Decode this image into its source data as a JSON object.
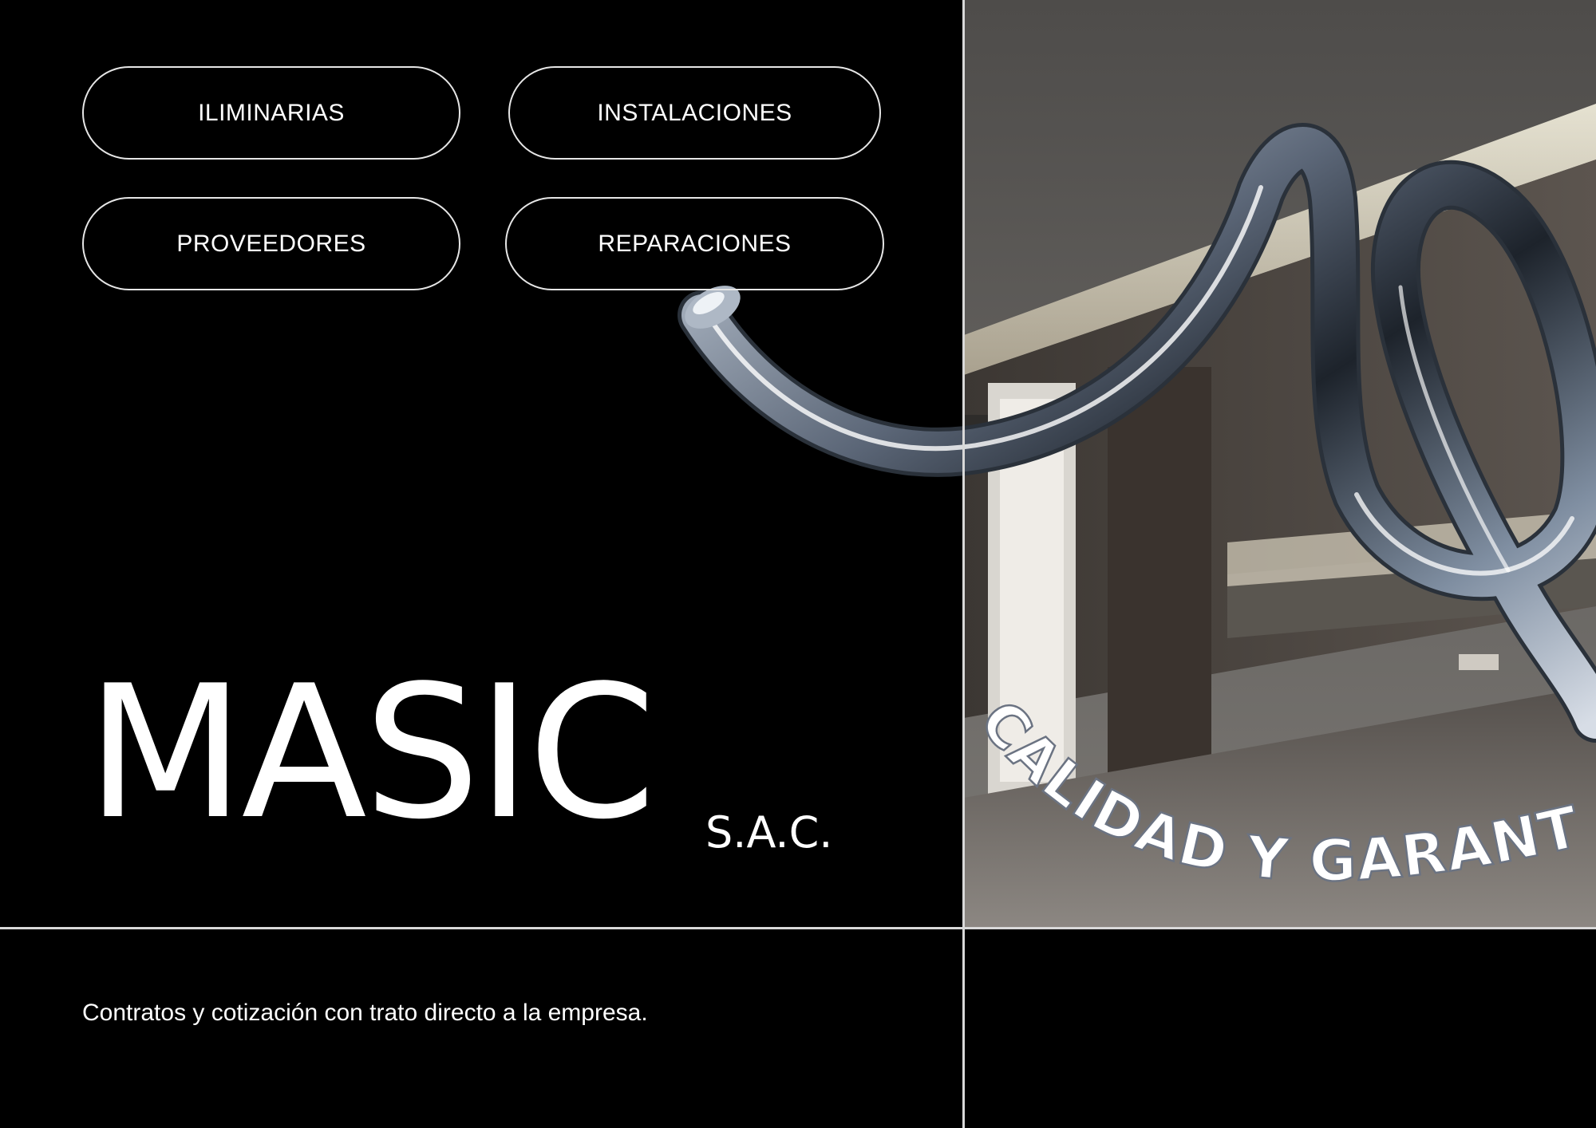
{
  "nav": {
    "buttons": [
      {
        "label": "ILIMINARIAS"
      },
      {
        "label": "INSTALACIONES"
      },
      {
        "label": "PROVEEDORES"
      },
      {
        "label": "REPARACIONES"
      }
    ]
  },
  "brand": {
    "name": "MASIC",
    "suffix": "S.A.C."
  },
  "tagline": "Contratos y cotización con trato directo a la empresa.",
  "hero": {
    "curved_text": "CALIDAD Y GARANTIA"
  },
  "colors": {
    "background": "#000000",
    "text": "#ffffff",
    "border": "#e6e6e6",
    "chrome": "#8a97a8"
  }
}
